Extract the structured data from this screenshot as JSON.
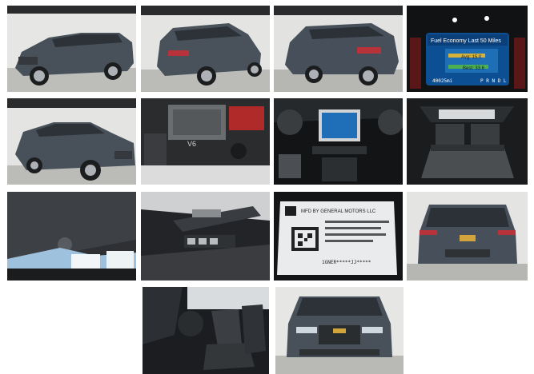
{
  "gallery": {
    "photos": [
      {
        "subject": "exterior-front-left"
      },
      {
        "subject": "exterior-rear-left"
      },
      {
        "subject": "exterior-rear-left-2"
      },
      {
        "subject": "fuel-economy-display"
      },
      {
        "subject": "exterior-front-left-2"
      },
      {
        "subject": "engine-bay"
      },
      {
        "subject": "dashboard-infotainment"
      },
      {
        "subject": "cargo-area"
      },
      {
        "subject": "headliner-sunroof"
      },
      {
        "subject": "door-panel"
      },
      {
        "subject": "window-sticker-label"
      },
      {
        "subject": "exterior-rear"
      },
      {
        "subject": "front-seats"
      },
      {
        "subject": "exterior-front"
      }
    ]
  },
  "fuel_display": {
    "title": "Fuel Economy Last 50 Miles",
    "avg_label": "Avg: 15.0",
    "best_label": "Best: 33.6",
    "odometer": "40025mi",
    "gear": "P R N D L"
  },
  "engine": {
    "badge": "V6"
  },
  "label": {
    "maker": "MFD BY GENERAL MOTORS LLC",
    "vin": "1GNER*****JJ*****"
  },
  "colors": {
    "vehicle": "#4a5258",
    "studio_wall": "#e4e4e2",
    "studio_floor": "#b9b9b6",
    "interior_dark": "#1b1d20",
    "screen_blue": "#1e6fb8",
    "chevy_gold": "#d1a53c"
  }
}
